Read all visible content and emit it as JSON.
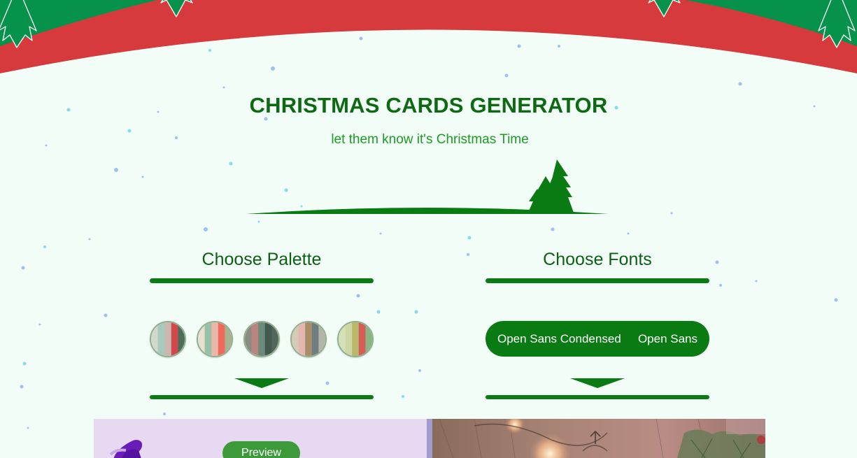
{
  "header": {
    "title": "CHRISTMAS CARDS GENERATOR",
    "subtitle": "let them know it's Christmas Time"
  },
  "palette_section": {
    "heading": "Choose Palette",
    "palettes": [
      {
        "name": "palette-1",
        "colors": [
          "#d3d8cd",
          "#a8c9bd",
          "#c9b7b0",
          "#d2474b",
          "#4c6d5a"
        ]
      },
      {
        "name": "palette-2",
        "colors": [
          "#e8dfcf",
          "#97c2a9",
          "#e9b7a7",
          "#ef6a5c",
          "#a8b28e"
        ]
      },
      {
        "name": "palette-3",
        "colors": [
          "#8b8b84",
          "#b9857f",
          "#6a8a7c",
          "#425a4f",
          "#55675c"
        ]
      },
      {
        "name": "palette-4",
        "colors": [
          "#d7cbb8",
          "#e4b8b1",
          "#a88d68",
          "#6e7d80",
          "#b3b5a8"
        ]
      },
      {
        "name": "palette-5",
        "colors": [
          "#d6e0b8",
          "#cdd6a2",
          "#b9b66e",
          "#d45e55",
          "#8ab481"
        ]
      }
    ]
  },
  "fonts_section": {
    "heading": "Choose Fonts",
    "options": [
      "Open Sans Condensed",
      "Open Sans"
    ]
  },
  "preview": {
    "button_label": "Preview"
  },
  "colors": {
    "banner_red": "#d63a3d",
    "banner_green": "#06924a",
    "accent_green": "#0a7a12",
    "background": "#f2fdf8"
  }
}
